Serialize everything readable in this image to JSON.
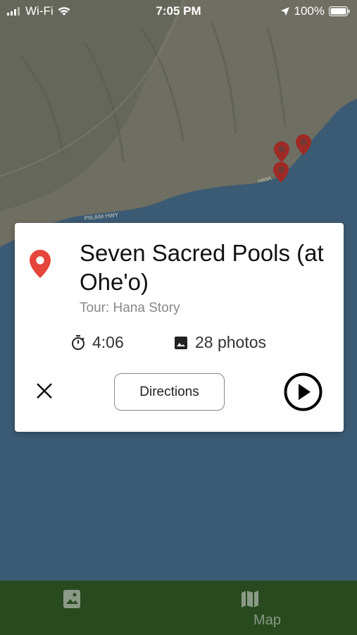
{
  "status_bar": {
    "carrier": "Wi-Fi",
    "time": "7:05 PM",
    "battery": "100%"
  },
  "map": {
    "road_labels": [
      "PIILANI HWY",
      "HANA"
    ],
    "land_color": "#6e6e62",
    "water_color": "#3b5a73",
    "pin_color": "#9e2a26"
  },
  "card": {
    "title": "Seven Sacred Pools (at Ohe'o)",
    "subtitle": "Tour: Hana Story",
    "duration": "4:06",
    "photos": "28 photos",
    "directions_label": "Directions",
    "pin_color": "#e5453a"
  },
  "tab_bar": {
    "tabs": [
      {
        "label": "",
        "icon": "image-icon"
      },
      {
        "label": "Map",
        "icon": "map-icon"
      }
    ],
    "background": "#274a1f"
  }
}
